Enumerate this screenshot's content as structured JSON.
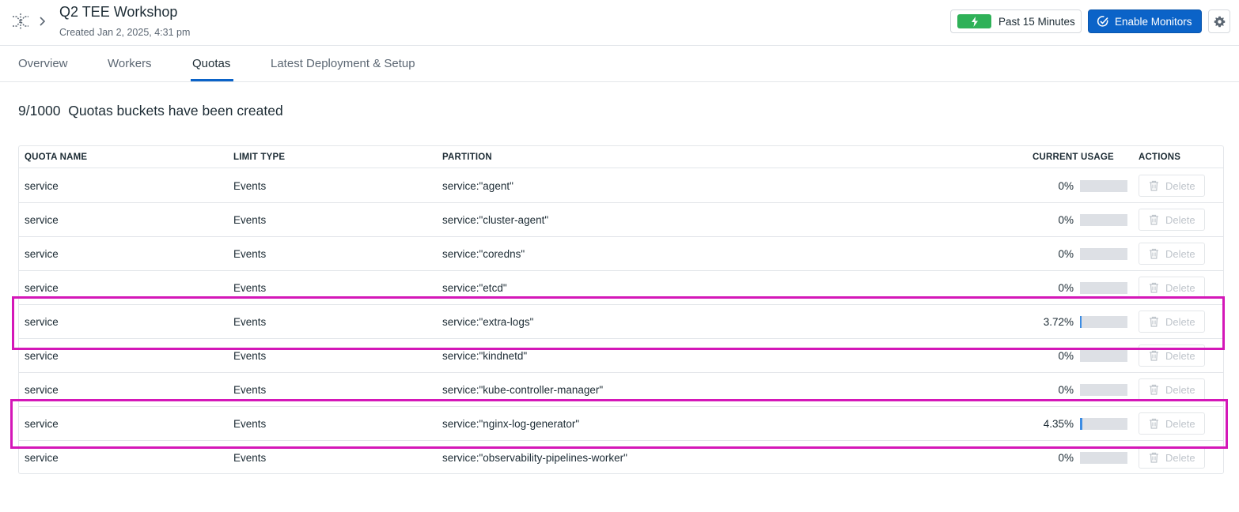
{
  "header": {
    "title": "Q2 TEE Workshop",
    "subtitle": "Created Jan 2, 2025, 4:31 pm",
    "time_range_label": "Past 15 Minutes",
    "enable_monitors_label": "Enable Monitors"
  },
  "tabs": [
    {
      "label": "Overview",
      "active": false
    },
    {
      "label": "Workers",
      "active": false
    },
    {
      "label": "Quotas",
      "active": true
    },
    {
      "label": "Latest Deployment & Setup",
      "active": false
    }
  ],
  "summary": {
    "count": "9/1000",
    "text": "Quotas buckets have been created"
  },
  "table": {
    "headers": [
      "QUOTA NAME",
      "LIMIT TYPE",
      "PARTITION",
      "CURRENT USAGE",
      "ACTIONS"
    ],
    "delete_label": "Delete",
    "rows": [
      {
        "name": "service",
        "limit_type": "Events",
        "partition": "service:\"agent\"",
        "usage": "0%",
        "usage_value": 0
      },
      {
        "name": "service",
        "limit_type": "Events",
        "partition": "service:\"cluster-agent\"",
        "usage": "0%",
        "usage_value": 0
      },
      {
        "name": "service",
        "limit_type": "Events",
        "partition": "service:\"coredns\"",
        "usage": "0%",
        "usage_value": 0
      },
      {
        "name": "service",
        "limit_type": "Events",
        "partition": "service:\"etcd\"",
        "usage": "0%",
        "usage_value": 0
      },
      {
        "name": "service",
        "limit_type": "Events",
        "partition": "service:\"extra-logs\"",
        "usage": "3.72%",
        "usage_value": 3.72
      },
      {
        "name": "service",
        "limit_type": "Events",
        "partition": "service:\"kindnetd\"",
        "usage": "0%",
        "usage_value": 0
      },
      {
        "name": "service",
        "limit_type": "Events",
        "partition": "service:\"kube-controller-manager\"",
        "usage": "0%",
        "usage_value": 0
      },
      {
        "name": "service",
        "limit_type": "Events",
        "partition": "service:\"nginx-log-generator\"",
        "usage": "4.35%",
        "usage_value": 4.35
      },
      {
        "name": "service",
        "limit_type": "Events",
        "partition": "service:\"observability-pipelines-worker\"",
        "usage": "0%",
        "usage_value": 0
      }
    ]
  },
  "colors": {
    "accent": "#0b63c8",
    "live_badge": "#2fb158",
    "highlight": "#d417b8",
    "usage_bar": "#3b8ce3"
  },
  "icons": {
    "app": "workflow-icon",
    "breadcrumb": "chevron-right-icon",
    "live": "lightning-icon",
    "monitors": "monitor-check-icon",
    "settings": "gear-icon",
    "delete": "trash-icon"
  }
}
